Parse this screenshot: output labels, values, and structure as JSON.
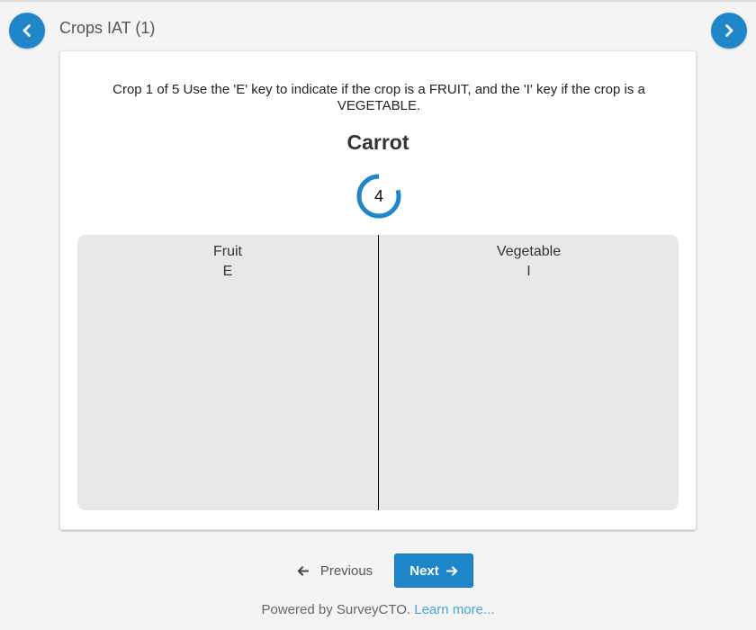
{
  "header": {
    "title": "Crops IAT (1)",
    "back_icon": "chevron-left-icon",
    "forward_icon": "chevron-right-icon"
  },
  "question": {
    "instruction": "Crop 1 of 5 Use the 'E' key to indicate if the crop is a FRUIT, and the 'I' key if the crop is a VEGETABLE.",
    "stimulus": "Carrot",
    "timer_value": "4",
    "timer_fraction_remaining": 0.8
  },
  "choices": [
    {
      "label": "Fruit",
      "key": "E"
    },
    {
      "label": "Vegetable",
      "key": "I"
    }
  ],
  "navigation": {
    "previous_label": "Previous",
    "next_label": "Next"
  },
  "footer": {
    "text": "Powered by SurveyCTO.",
    "link": "Learn more..."
  },
  "colors": {
    "accent": "#1f86c9",
    "panel_bg": "#e8e8e8",
    "link": "#4aa3d8"
  }
}
